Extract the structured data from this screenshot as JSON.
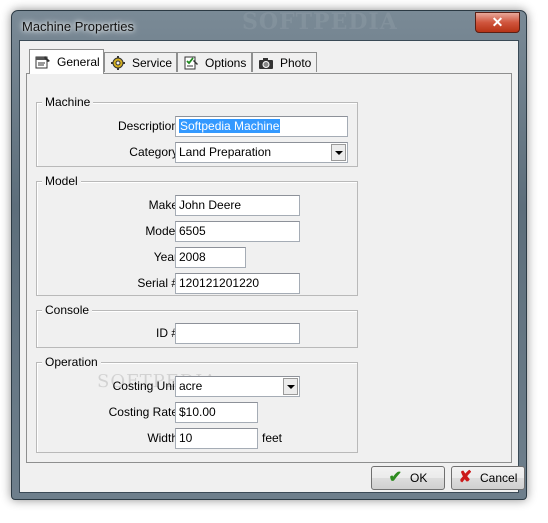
{
  "window": {
    "title": "Machine Properties",
    "watermark": "SOFTPEDIA",
    "close_glyph": "✕"
  },
  "tabs": [
    {
      "label": "General",
      "icon": "properties-icon",
      "active": true
    },
    {
      "label": "Service",
      "icon": "gear-icon",
      "active": false
    },
    {
      "label": "Options",
      "icon": "checklist-icon",
      "active": false
    },
    {
      "label": "Photo",
      "icon": "camera-icon",
      "active": false
    }
  ],
  "machine": {
    "legend": "Machine",
    "description_label": "Description",
    "description_value": "Softpedia Machine",
    "category_label": "Category",
    "category_value": "Land Preparation"
  },
  "model": {
    "legend": "Model",
    "make_label": "Make",
    "make_value": "John Deere",
    "model_label": "Model",
    "model_value": "6505",
    "year_label": "Year",
    "year_value": "2008",
    "serial_label": "Serial #",
    "serial_value": "120121201220"
  },
  "console": {
    "legend": "Console",
    "id_label": "ID #",
    "id_value": ""
  },
  "operation": {
    "legend": "Operation",
    "costing_unit_label": "Costing Unit",
    "costing_unit_value": "acre",
    "costing_rate_label": "Costing Rate",
    "costing_rate_value": "$10.00",
    "width_label": "Width",
    "width_value": "10",
    "width_unit": "feet",
    "watermark": "SOFTPEDIA"
  },
  "buttons": {
    "ok_label": "OK",
    "ok_glyph": "✔",
    "cancel_label": "Cancel",
    "cancel_glyph": "✘"
  }
}
